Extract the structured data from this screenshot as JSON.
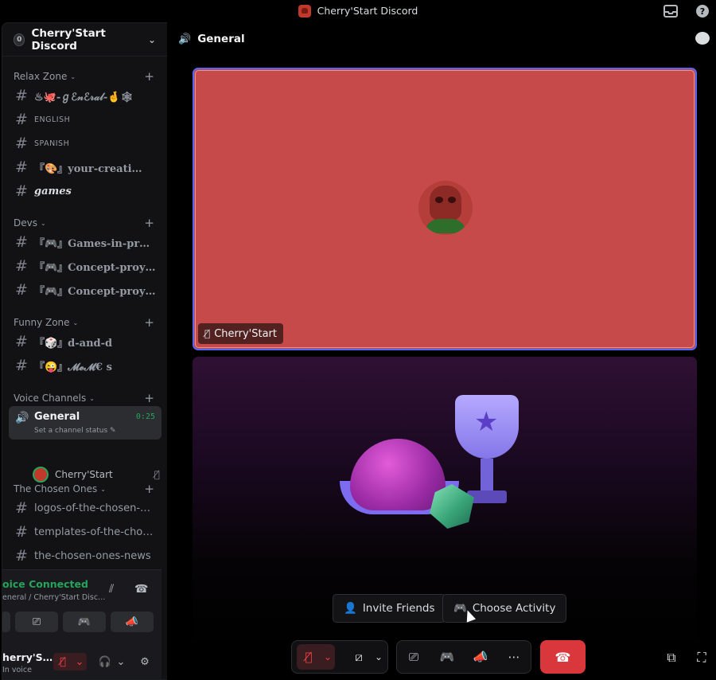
{
  "window": {
    "title": "Cherry'Start Discord"
  },
  "server": {
    "badge": "0",
    "name": "Cherry'Start Discord"
  },
  "categories": [
    {
      "name": "Relax Zone"
    },
    {
      "name": "Devs"
    },
    {
      "name": "Funny Zone"
    },
    {
      "name": "Voice Channels"
    },
    {
      "name": "The Chosen Ones"
    }
  ],
  "channels": {
    "general_text": "♨🐙-ℊℰ𝓃ℰ𝓇𝒶𝓁-🤞🕸",
    "english": "ENGLISH",
    "spanish": "SPANISH",
    "your_creations": "『🎨』your-creati…",
    "games": "games",
    "games_in_progress": "『🎮』Games-in-pr…",
    "concept_1": "『🎮』Concept-proy…",
    "concept_2": "『🎮』Concept-proy…",
    "d_and_d": "『🎲』d-and-d",
    "memes": "『😜』𝓜𝓮𝓜€ s",
    "logos": "logos-of-the-chosen-…",
    "templates": "templates-of-the-cho…",
    "news": "the-chosen-ones-news"
  },
  "voice_channel": {
    "name": "General",
    "timer": "0:25",
    "status": "Set a channel status",
    "member": "Cherry'Start"
  },
  "voice_panel": {
    "title": "oice Connected",
    "subtitle": "eneral / Cherry'Start Disc…",
    "user_name": "herry'S…",
    "user_status": "In voice"
  },
  "main": {
    "channel_title": "General",
    "participant_name": "Cherry'Start",
    "invite_label": "Invite Friends",
    "activity_label": "Choose Activity"
  },
  "colors": {
    "accent": "#5865f2",
    "online": "#23a55a",
    "danger": "#da373c",
    "tile_bg": "#c64a49"
  }
}
